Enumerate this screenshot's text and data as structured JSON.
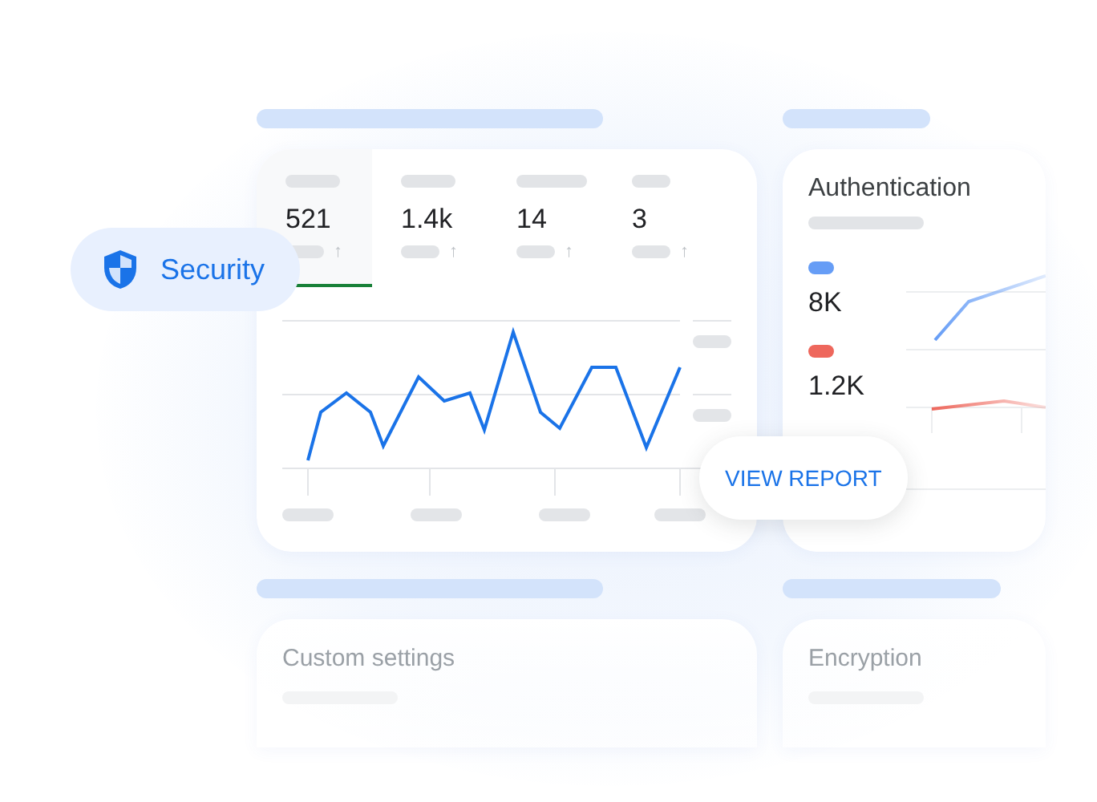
{
  "security_chip": {
    "label": "Security"
  },
  "overview": {
    "stats": [
      {
        "value": "521",
        "trend": "↑",
        "selected": true
      },
      {
        "value": "1.4k",
        "trend": "↑",
        "selected": false
      },
      {
        "value": "14",
        "trend": "↑",
        "selected": false
      },
      {
        "value": "3",
        "trend": "↑",
        "selected": false
      }
    ]
  },
  "view_report_button": {
    "label": "VIEW REPORT"
  },
  "authentication": {
    "title": "Authentication",
    "series": [
      {
        "value": "8K",
        "color": "#669df6"
      },
      {
        "value": "1.2K",
        "color": "#ee675c"
      }
    ]
  },
  "custom_settings": {
    "title": "Custom settings"
  },
  "encryption": {
    "title": "Encryption"
  }
}
